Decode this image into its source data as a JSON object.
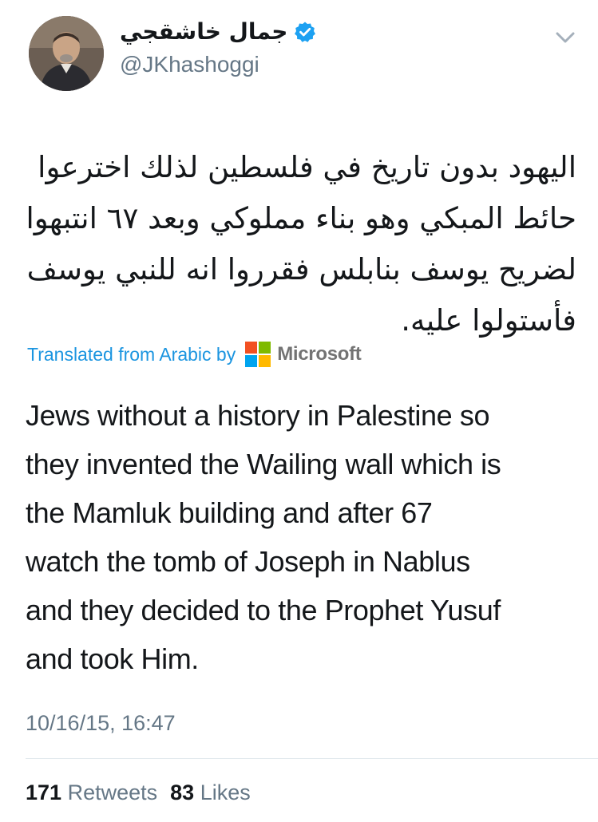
{
  "user": {
    "display_name": "جمال خاشقجي",
    "handle": "@JKhashoggi"
  },
  "icons": {
    "verified": "verified-badge-icon",
    "menu": "chevron-down-icon",
    "translator_logo": "microsoft-logo-icon"
  },
  "tweet": {
    "arabic_lines": [
      "اليهود بدون تاريخ في فلسطين لذلك اخترعوا",
      "حائط المبكي وهو بناء مملوكي وبعد ٦٧ انتبهوا",
      "لضريح يوسف بنابلس فقرروا انه للنبي يوسف",
      "فأستولوا عليه."
    ],
    "translated_label": "Translated from Arabic by",
    "translator_name": "Microsoft",
    "english_lines": [
      "Jews without a history in Palestine so",
      "they invented the Wailing wall which is",
      "the Mamluk building and after 67",
      "watch the tomb of Joseph in Nablus",
      "and they decided to the Prophet Yusuf",
      "and took Him."
    ],
    "timestamp": "10/16/15, 16:47"
  },
  "stats": {
    "retweets_count": "171",
    "retweets_label": "Retweets",
    "likes_count": "83",
    "likes_label": "Likes"
  },
  "colors": {
    "link_blue": "#1b95e0",
    "verified_blue": "#1da1f2",
    "muted_gray": "#657786",
    "ms_red": "#f25022",
    "ms_green": "#7fba00",
    "ms_blue": "#00a4ef",
    "ms_yellow": "#ffb900"
  }
}
